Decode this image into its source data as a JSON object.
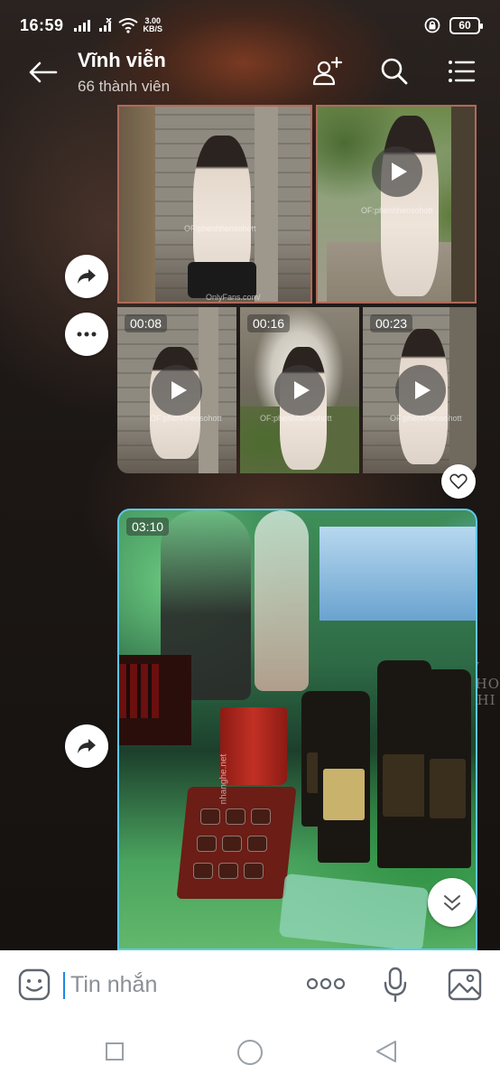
{
  "status_bar": {
    "time": "16:59",
    "net_speed_value": "3.00",
    "net_speed_unit": "KB/S",
    "battery": "60"
  },
  "header": {
    "title": "Vĩnh viễn",
    "subtitle": "66 thành viên"
  },
  "album_one": {
    "top_watermark": "OF:phenhhensohott",
    "top_watermark_2": "OF:phenhhensohott",
    "site_mark": "OnlyFans.com/",
    "videos": [
      {
        "duration": "00:08",
        "watermark": "OF:phenhhensohott"
      },
      {
        "duration": "00:16",
        "watermark": "OF:phenhhensohott"
      },
      {
        "duration": "00:23",
        "watermark": "OF:phenhhensohott"
      }
    ]
  },
  "video_two": {
    "duration": "03:10",
    "side_text": "nhanghe.net"
  },
  "wallpaper_text": [
    "W",
    "PHO",
    "GHI"
  ],
  "input": {
    "placeholder": "Tin nhắn"
  },
  "colors": {
    "accent": "#1e88e5",
    "video_border": "#5ec8f0",
    "album_border": "#b06a5a"
  }
}
